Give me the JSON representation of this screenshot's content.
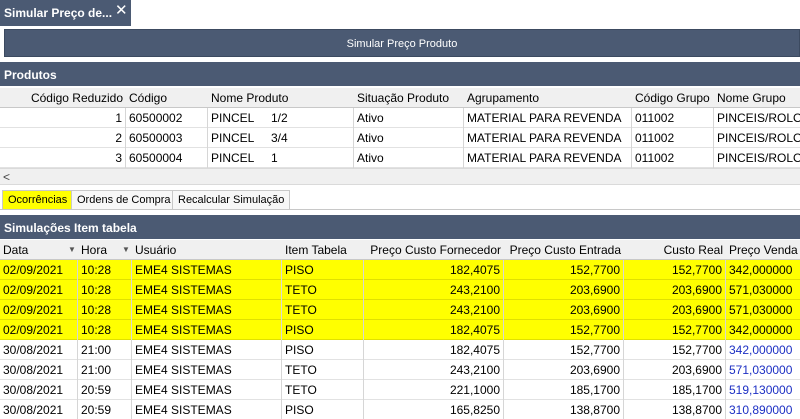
{
  "window_tab": {
    "title": "Simular Preço de..."
  },
  "action": {
    "label": "Simular Preço Produto"
  },
  "produtos": {
    "title": "Produtos",
    "columns": [
      "Código Reduzido",
      "Código",
      "Nome Produto",
      "Situação Produto",
      "Agrupamento",
      "Código Grupo",
      "Nome Grupo"
    ],
    "rows": [
      [
        "1",
        "60500002",
        "PINCEL",
        "1/2",
        "Ativo",
        "MATERIAL PARA REVENDA",
        "011002",
        "PINCEIS/ROLO"
      ],
      [
        "2",
        "60500003",
        "PINCEL",
        "3/4",
        "Ativo",
        "MATERIAL PARA REVENDA",
        "011002",
        "PINCEIS/ROLO"
      ],
      [
        "3",
        "60500004",
        "PINCEL",
        "1",
        "Ativo",
        "MATERIAL PARA REVENDA",
        "011002",
        "PINCEIS/ROLO"
      ]
    ]
  },
  "tabs": [
    {
      "label": "Ocorrências",
      "active": true
    },
    {
      "label": "Ordens de Compra",
      "active": false
    },
    {
      "label": "Recalcular Simulação",
      "active": false
    }
  ],
  "simulacoes": {
    "title": "Simulações Item tabela",
    "columns": [
      "Data",
      "Hora",
      "Usuário",
      "Item Tabela",
      "Preço Custo Fornecedor",
      "Preço Custo Entrada",
      "Custo Real",
      "Preço Venda"
    ],
    "rows": [
      {
        "cells": [
          "02/09/2021",
          "10:28",
          "EME4 SISTEMAS",
          "PISO",
          "182,4075",
          "152,7700",
          "152,7700",
          "342,000000"
        ],
        "highlight": true
      },
      {
        "cells": [
          "02/09/2021",
          "10:28",
          "EME4 SISTEMAS",
          "TETO",
          "243,2100",
          "203,6900",
          "203,6900",
          "571,030000"
        ],
        "highlight": true
      },
      {
        "cells": [
          "02/09/2021",
          "10:28",
          "EME4 SISTEMAS",
          "TETO",
          "243,2100",
          "203,6900",
          "203,6900",
          "571,030000"
        ],
        "highlight": true
      },
      {
        "cells": [
          "02/09/2021",
          "10:28",
          "EME4 SISTEMAS",
          "PISO",
          "182,4075",
          "152,7700",
          "152,7700",
          "342,000000"
        ],
        "highlight": true
      },
      {
        "cells": [
          "30/08/2021",
          "21:00",
          "EME4 SISTEMAS",
          "PISO",
          "182,4075",
          "152,7700",
          "152,7700",
          "342,000000"
        ],
        "highlight": false
      },
      {
        "cells": [
          "30/08/2021",
          "21:00",
          "EME4 SISTEMAS",
          "TETO",
          "243,2100",
          "203,6900",
          "203,6900",
          "571,030000"
        ],
        "highlight": false
      },
      {
        "cells": [
          "30/08/2021",
          "20:59",
          "EME4 SISTEMAS",
          "TETO",
          "221,1000",
          "185,1700",
          "185,1700",
          "519,130000"
        ],
        "highlight": false
      },
      {
        "cells": [
          "30/08/2021",
          "20:59",
          "EME4 SISTEMAS",
          "PISO",
          "165,8250",
          "138,8700",
          "138,8700",
          "310,890000"
        ],
        "highlight": false
      }
    ]
  },
  "colors": {
    "header_bg": "#4b5a73",
    "highlight": "#ffff00",
    "price_blue": "#1c2fc4"
  }
}
